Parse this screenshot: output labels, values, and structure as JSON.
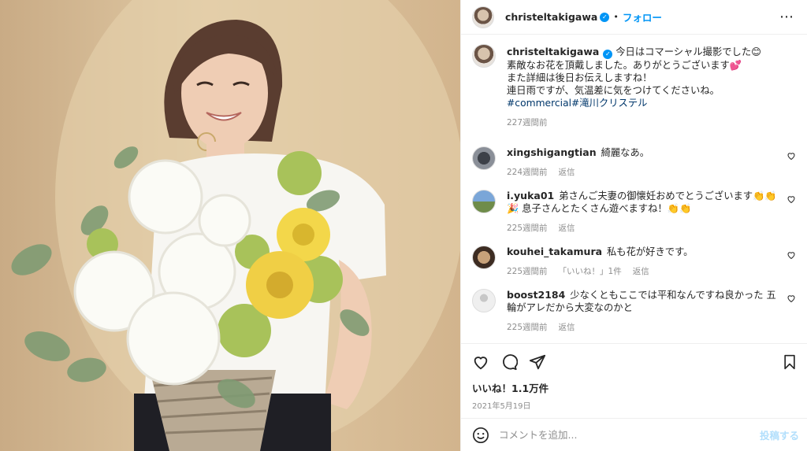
{
  "post": {
    "username": "christeltakigawa",
    "follow_label": "フォロー",
    "caption_lines": [
      "今日はコマーシャル撮影でした😊",
      "素敵なお花を頂戴しました。ありがとうございます💕",
      "また詳細は後日お伝えしますね！",
      "連日雨ですが、気温差に気をつけてくださいね。"
    ],
    "hashtags": "#commercial#滝川クリステル",
    "caption_time": "227週間前"
  },
  "comments": [
    {
      "username": "xingshigangtian",
      "text": "綺麗なあ。",
      "time": "224週間前",
      "reply": "返信"
    },
    {
      "username": "i.yuka01",
      "text": "弟さんご夫妻の御懐妊おめでとうございます👏👏🎉 息子さんとたくさん遊べますね！👏👏",
      "time": "225週間前",
      "reply": "返信"
    },
    {
      "username": "kouhei_takamura",
      "text": "私も花が好きです。",
      "time": "225週間前",
      "likes": "「いいね！」1件",
      "reply": "返信"
    },
    {
      "username": "boost2184",
      "text": "少なくともここでは平和なんですね良かった 五輪がアレだから大変なのかと",
      "time": "225週間前",
      "reply": "返信"
    }
  ],
  "footer": {
    "likes": "いいね！1.1万件",
    "date": "2021年5月19日",
    "comment_placeholder": "コメントを追加...",
    "post_label": "投稿する"
  },
  "colors": {
    "accent": "#0095f6",
    "hashtag": "#00376b",
    "muted": "#8e8e8e"
  }
}
